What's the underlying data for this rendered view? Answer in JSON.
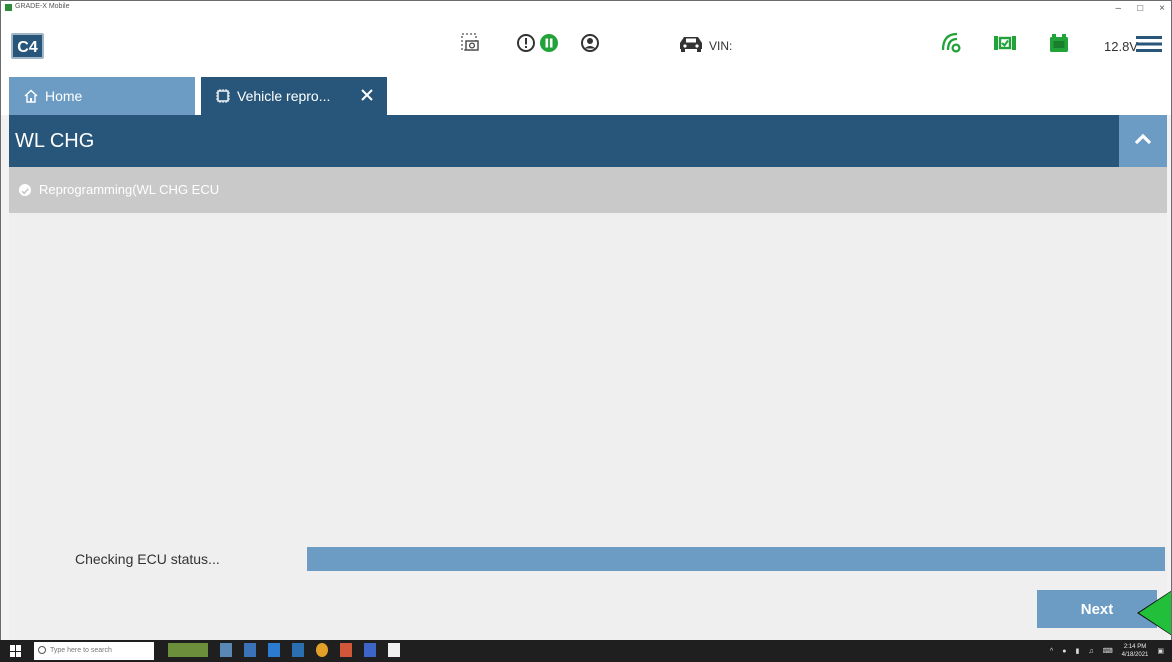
{
  "window": {
    "title": "GRADE-X Mobile",
    "controls": [
      "–",
      "□",
      "×"
    ]
  },
  "toolbar": {
    "logo": "C4",
    "vin_label": "VIN:",
    "voltage": "12.8V"
  },
  "tabs": [
    {
      "label": "Home",
      "icon": "home-icon"
    },
    {
      "label": "Vehicle repro...",
      "icon": "chip-icon",
      "closable": true
    }
  ],
  "section": {
    "title": "WL CHG"
  },
  "step": {
    "label": "Reprogramming(WL CHG ECU"
  },
  "status": {
    "text": "Checking ECU status...",
    "progress_percent": 100
  },
  "buttons": {
    "next": "Next"
  },
  "taskbar": {
    "search_placeholder": "Type here to search",
    "time": "2:14 PM",
    "date": "4/18/2021"
  },
  "colors": {
    "primary_dark": "#27567a",
    "primary_light": "#6c9cc3",
    "accent_green": "#22a33a",
    "pointer_green": "#22c03a"
  }
}
